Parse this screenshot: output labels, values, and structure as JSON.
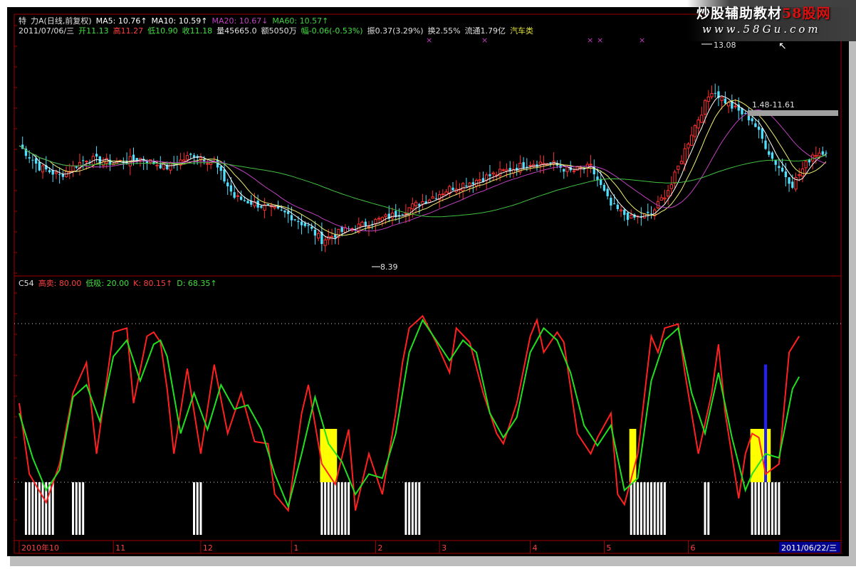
{
  "watermark": {
    "title_prefix": "炒股辅助教材",
    "title_suffix": "58股网",
    "url": "www.58Gu.com"
  },
  "header": {
    "line1": [
      {
        "text": "特",
        "color": "#e0e0e0"
      },
      {
        "text": "力A(日线,前复权)",
        "color": "#e0e0e0"
      },
      {
        "text": "MA5: 10.76↑",
        "color": "#ffffff"
      },
      {
        "text": "MA10: 10.59↑",
        "color": "#ffffff"
      },
      {
        "text": "MA20: 10.67↓",
        "color": "#c040c0"
      },
      {
        "text": "MA60: 10.57↑",
        "color": "#40d040"
      }
    ],
    "line2": [
      {
        "text": "2011/07/06/三",
        "color": "#e0e0e0"
      },
      {
        "text": "开11.13",
        "color": "#40e040"
      },
      {
        "text": "高11.27",
        "color": "#ff4040"
      },
      {
        "text": "低10.90",
        "color": "#40e040"
      },
      {
        "text": "收11.18",
        "color": "#40e040"
      },
      {
        "text": "量45665.0",
        "color": "#e0e0e0"
      },
      {
        "text": "额5050万",
        "color": "#e0e0e0"
      },
      {
        "text": "幅-0.06(-0.53%)",
        "color": "#40e040"
      },
      {
        "text": "振0.37(3.29%)",
        "color": "#e0e0e0"
      },
      {
        "text": "换2.55%",
        "color": "#e0e0e0"
      },
      {
        "text": "流通1.79亿",
        "color": "#e0e0e0"
      },
      {
        "text": "汽车类",
        "color": "#e0e040"
      }
    ]
  },
  "price_annotations": {
    "high_label": "13.08",
    "low_label": "8.39",
    "range_label": "1.48-11.61"
  },
  "kdj_header": [
    {
      "text": "C54",
      "color": "#e0e0e0"
    },
    {
      "text": "高卖: 80.00",
      "color": "#ff4040"
    },
    {
      "text": "低吸: 20.00",
      "color": "#40e040"
    },
    {
      "text": "K: 80.15↑",
      "color": "#ff4040"
    },
    {
      "text": "D: 68.35↑",
      "color": "#40e040"
    }
  ],
  "x_axis": {
    "labels": [
      "2010年10",
      "11",
      "12",
      "1",
      "2",
      "3",
      "4",
      "5",
      "6"
    ],
    "cursor_date": "2011/06/22/三"
  },
  "colors": {
    "background": "#000000",
    "frame": "#a00000",
    "candle_up": "#ff3030",
    "candle_down": "#50e0ff",
    "ma5": "#ffffff",
    "ma10": "#f0f070",
    "ma20": "#c040c0",
    "ma60": "#40c040",
    "k_line": "#ff2020",
    "d_line": "#20e020",
    "signal_white": "#ffffff",
    "signal_yellow": "#ffff00",
    "signal_blue": "#2020ff"
  },
  "chart_data": [
    {
      "type": "candlestick",
      "title": "特力A(日线,前复权)",
      "series": [
        {
          "name": "MA5",
          "value": 10.76
        },
        {
          "name": "MA10",
          "value": 10.59
        },
        {
          "name": "MA20",
          "value": 10.67
        },
        {
          "name": "MA60",
          "value": 10.57
        }
      ],
      "close_path": [
        [
          0,
          10.9
        ],
        [
          6,
          10.4
        ],
        [
          12,
          10.2
        ],
        [
          20,
          10.6
        ],
        [
          28,
          10.5
        ],
        [
          36,
          10.6
        ],
        [
          44,
          10.4
        ],
        [
          52,
          10.7
        ],
        [
          58,
          10.5
        ],
        [
          64,
          9.7
        ],
        [
          72,
          9.5
        ],
        [
          80,
          9.3
        ],
        [
          86,
          9.0
        ],
        [
          90,
          8.7
        ],
        [
          96,
          8.9
        ],
        [
          104,
          9.1
        ],
        [
          112,
          9.3
        ],
        [
          120,
          9.6
        ],
        [
          128,
          9.9
        ],
        [
          136,
          10.1
        ],
        [
          144,
          10.3
        ],
        [
          152,
          10.5
        ],
        [
          158,
          10.5
        ],
        [
          164,
          10.3
        ],
        [
          170,
          10.4
        ],
        [
          176,
          9.5
        ],
        [
          182,
          9.2
        ],
        [
          188,
          9.3
        ],
        [
          194,
          10.0
        ],
        [
          200,
          11.2
        ],
        [
          206,
          12.2
        ],
        [
          212,
          11.8
        ],
        [
          218,
          11.5
        ],
        [
          224,
          10.6
        ],
        [
          230,
          10.0
        ],
        [
          236,
          10.7
        ],
        [
          240,
          10.8
        ]
      ],
      "ylim": [
        8.0,
        13.3
      ],
      "annotations": {
        "high": 13.08,
        "low": 8.39
      }
    },
    {
      "type": "line",
      "title": "C54",
      "series": [
        {
          "name": "K",
          "last": 80.15
        },
        {
          "name": "D",
          "last": 68.35
        }
      ],
      "thresholds": {
        "high_sell": 80.0,
        "low_buy": 20.0
      },
      "k_path": [
        [
          0,
          55
        ],
        [
          3,
          20
        ],
        [
          8,
          6
        ],
        [
          12,
          25
        ],
        [
          16,
          60
        ],
        [
          20,
          75
        ],
        [
          23,
          30
        ],
        [
          28,
          90
        ],
        [
          32,
          92
        ],
        [
          34,
          55
        ],
        [
          38,
          88
        ],
        [
          40,
          90
        ],
        [
          42,
          85
        ],
        [
          44,
          62
        ],
        [
          46,
          30
        ],
        [
          50,
          72
        ],
        [
          54,
          30
        ],
        [
          58,
          74
        ],
        [
          62,
          40
        ],
        [
          66,
          60
        ],
        [
          70,
          36
        ],
        [
          74,
          35
        ],
        [
          76,
          10
        ],
        [
          80,
          2
        ],
        [
          84,
          50
        ],
        [
          86,
          64
        ],
        [
          90,
          25
        ],
        [
          94,
          15
        ],
        [
          98,
          42
        ],
        [
          100,
          2
        ],
        [
          104,
          30
        ],
        [
          108,
          10
        ],
        [
          112,
          50
        ],
        [
          114,
          75
        ],
        [
          116,
          92
        ],
        [
          120,
          98
        ],
        [
          124,
          85
        ],
        [
          128,
          70
        ],
        [
          130,
          92
        ],
        [
          134,
          85
        ],
        [
          138,
          60
        ],
        [
          142,
          40
        ],
        [
          144,
          35
        ],
        [
          148,
          55
        ],
        [
          152,
          88
        ],
        [
          154,
          96
        ],
        [
          156,
          80
        ],
        [
          160,
          90
        ],
        [
          162,
          85
        ],
        [
          166,
          40
        ],
        [
          170,
          30
        ],
        [
          172,
          38
        ],
        [
          176,
          50
        ],
        [
          178,
          10
        ],
        [
          180,
          5
        ],
        [
          184,
          30
        ],
        [
          188,
          88
        ],
        [
          190,
          80
        ],
        [
          192,
          92
        ],
        [
          196,
          94
        ],
        [
          198,
          70
        ],
        [
          202,
          30
        ],
        [
          206,
          60
        ],
        [
          208,
          84
        ],
        [
          210,
          50
        ],
        [
          214,
          8
        ],
        [
          216,
          30
        ],
        [
          218,
          40
        ],
        [
          220,
          38
        ],
        [
          222,
          20
        ],
        [
          226,
          25
        ],
        [
          229,
          80
        ],
        [
          232,
          88
        ]
      ],
      "d_path": [
        [
          0,
          50
        ],
        [
          4,
          28
        ],
        [
          8,
          12
        ],
        [
          12,
          22
        ],
        [
          16,
          58
        ],
        [
          20,
          64
        ],
        [
          24,
          46
        ],
        [
          28,
          78
        ],
        [
          32,
          86
        ],
        [
          36,
          66
        ],
        [
          40,
          84
        ],
        [
          42,
          86
        ],
        [
          44,
          78
        ],
        [
          48,
          40
        ],
        [
          52,
          60
        ],
        [
          56,
          42
        ],
        [
          60,
          64
        ],
        [
          64,
          52
        ],
        [
          68,
          54
        ],
        [
          72,
          42
        ],
        [
          76,
          20
        ],
        [
          80,
          4
        ],
        [
          84,
          30
        ],
        [
          88,
          58
        ],
        [
          92,
          35
        ],
        [
          96,
          26
        ],
        [
          100,
          10
        ],
        [
          104,
          20
        ],
        [
          108,
          18
        ],
        [
          112,
          40
        ],
        [
          116,
          80
        ],
        [
          120,
          96
        ],
        [
          124,
          86
        ],
        [
          128,
          76
        ],
        [
          132,
          86
        ],
        [
          136,
          80
        ],
        [
          140,
          50
        ],
        [
          144,
          38
        ],
        [
          148,
          48
        ],
        [
          152,
          80
        ],
        [
          156,
          92
        ],
        [
          160,
          86
        ],
        [
          164,
          70
        ],
        [
          168,
          44
        ],
        [
          172,
          34
        ],
        [
          176,
          44
        ],
        [
          180,
          12
        ],
        [
          184,
          18
        ],
        [
          188,
          66
        ],
        [
          192,
          86
        ],
        [
          196,
          92
        ],
        [
          200,
          60
        ],
        [
          204,
          40
        ],
        [
          208,
          70
        ],
        [
          212,
          38
        ],
        [
          216,
          12
        ],
        [
          218,
          20
        ],
        [
          222,
          30
        ],
        [
          226,
          28
        ],
        [
          230,
          62
        ],
        [
          232,
          68
        ]
      ],
      "ylim": [
        -10,
        110
      ],
      "white_signals": [
        [
          2,
          10
        ],
        [
          16,
          19
        ],
        [
          52,
          54
        ],
        [
          90,
          98
        ],
        [
          115,
          119
        ],
        [
          182,
          192
        ],
        [
          204,
          205
        ],
        [
          218,
          226
        ]
      ],
      "yellow_signals": [
        [
          90,
          94
        ],
        [
          182,
          183
        ],
        [
          218,
          223
        ]
      ],
      "blue_signal": {
        "at": 222,
        "value": 60
      }
    }
  ]
}
